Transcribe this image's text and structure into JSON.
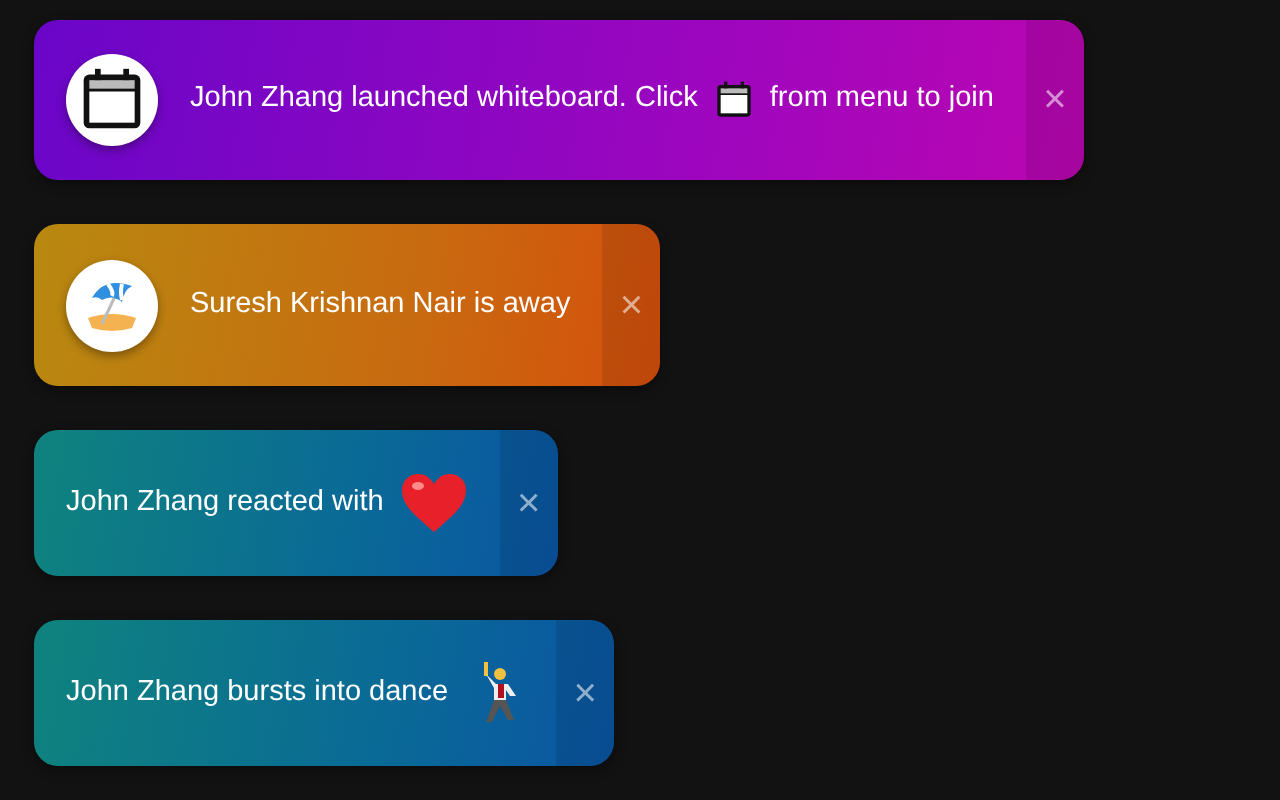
{
  "toasts": [
    {
      "kind": "whiteboard",
      "avatar": {
        "kind": "calendar"
      },
      "parts": [
        {
          "kind": "text",
          "text": "John Zhang launched whiteboard. Click"
        },
        {
          "kind": "calendar"
        },
        {
          "kind": "text",
          "text": "from menu to join"
        }
      ],
      "close": "×"
    },
    {
      "kind": "status",
      "avatar": {
        "kind": "beach"
      },
      "parts": [
        {
          "kind": "text",
          "text": "Suresh Krishnan Nair is away"
        }
      ],
      "close": "×"
    },
    {
      "kind": "reaction",
      "parts": [
        {
          "kind": "text",
          "text": "John Zhang reacted with"
        },
        {
          "kind": "heart"
        }
      ],
      "close": "×"
    },
    {
      "kind": "reaction",
      "parts": [
        {
          "kind": "text",
          "text": "John Zhang bursts into dance"
        },
        {
          "kind": "dancer"
        }
      ],
      "close": "×"
    }
  ]
}
